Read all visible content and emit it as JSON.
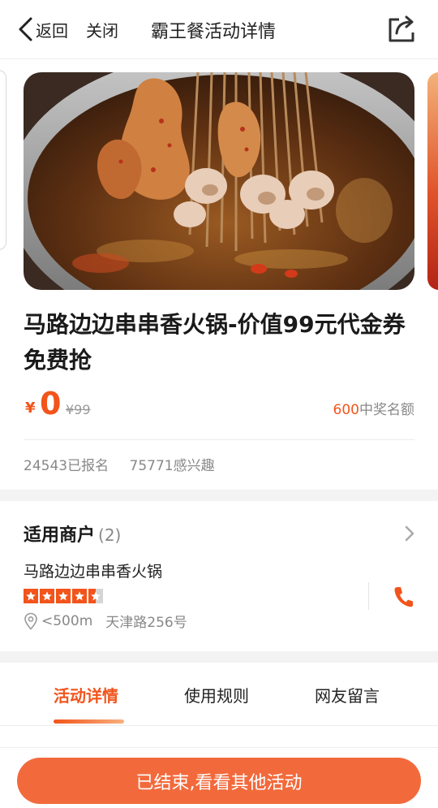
{
  "header": {
    "back_label": "返回",
    "close_label": "关闭",
    "title": "霸王餐活动详情",
    "share_icon": "share-icon"
  },
  "carousel": {
    "image_subject": "skewers-in-hot-pot-photo"
  },
  "deal": {
    "title": "马路边边串串香火锅-价值99元代金券免费抢",
    "currency": "¥",
    "price": "0",
    "original_price": "¥99",
    "quota_number": "600",
    "quota_label": "中奖名额",
    "signed_up": "24543已报名",
    "interested": "75771感兴趣"
  },
  "merchant": {
    "heading": "适用商户",
    "count": "(2)",
    "name": "马路边边串串香火锅",
    "rating": 4.5,
    "rating_max": 5,
    "distance": "<500m",
    "address": "天津路256号"
  },
  "tabs": [
    {
      "label": "活动详情",
      "active": true
    },
    {
      "label": "使用规则",
      "active": false
    },
    {
      "label": "网友留言",
      "active": false
    }
  ],
  "cta": {
    "label": "已结束,看看其他活动"
  },
  "colors": {
    "accent": "#f2541b",
    "cta_background": "#f26a3c",
    "muted_text": "#888888",
    "section_gap": "#f3f3f3"
  }
}
